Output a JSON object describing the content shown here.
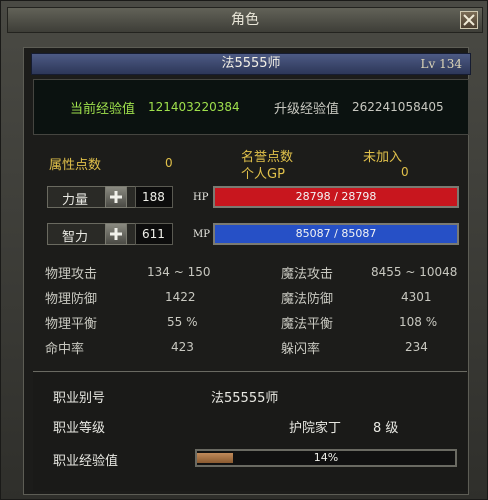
{
  "window": {
    "title": "角色"
  },
  "character": {
    "name": "法5555师",
    "level": "Lv 134"
  },
  "exp": {
    "current_label": "当前经验值",
    "current_value": "121403220384",
    "upgrade_label": "升级经验值",
    "upgrade_value": "262241058405"
  },
  "attributes": {
    "points_label": "属性点数",
    "points_value": "0",
    "honor_label": "名誉点数",
    "honor_value": "未加入",
    "gp_label": "个人GP",
    "gp_value": "0"
  },
  "strength": {
    "label": "力量",
    "value": "188"
  },
  "intelligence": {
    "label": "智力",
    "value": "611"
  },
  "hp": {
    "tag": "HP",
    "text": "28798 / 28798",
    "fraction": 1.0,
    "color": "#c8161e"
  },
  "mp": {
    "tag": "MP",
    "text": "85087 / 85087",
    "fraction": 1.0,
    "color": "#2650c6"
  },
  "stats": {
    "phys_atk_label": "物理攻击",
    "phys_atk_value": "134 ~ 150",
    "phys_def_label": "物理防御",
    "phys_def_value": "1422",
    "phys_bal_label": "物理平衡",
    "phys_bal_value": "55 %",
    "hit_label": "命中率",
    "hit_value": "423",
    "mag_atk_label": "魔法攻击",
    "mag_atk_value": "8455 ~ 10048",
    "mag_def_label": "魔法防御",
    "mag_def_value": "4301",
    "mag_bal_label": "魔法平衡",
    "mag_bal_value": "108 %",
    "evade_label": "躲闪率",
    "evade_value": "234"
  },
  "job": {
    "title_label": "职业别号",
    "title_value": "法55555师",
    "rank_label": "职业等级",
    "rank_name": "护院家丁",
    "rank_level": "8 级",
    "exp_label": "职业经验值",
    "exp_text": "14%",
    "exp_fraction": 0.14
  }
}
